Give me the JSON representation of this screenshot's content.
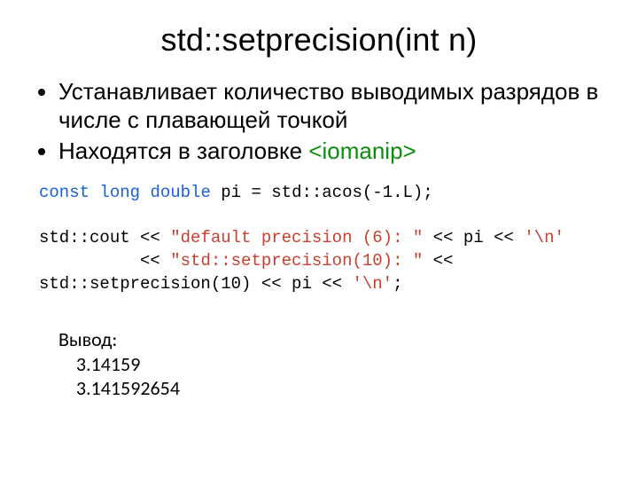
{
  "title": "std::setprecision(int n)",
  "bullets": [
    {
      "pre": "Устанавливает количество выводимых разрядов в числе с плавающей точкой",
      "header": ""
    },
    {
      "pre": "Находятся в заголовке ",
      "header": "<iomanip>"
    }
  ],
  "code": {
    "kw1": "const",
    "kw2": "long",
    "kw3": "double",
    "line1_rest": " pi = std::acos(-1.L);",
    "cout": "std::cout << ",
    "str1": "\"default precision (6): \"",
    "mid1": " << pi << ",
    "chr1": "'\\n'",
    "indent2": "          << ",
    "str2": "\"std::setprecision(10): \"",
    "mid2": " << ",
    "line3": "std::setprecision(10) << pi << ",
    "chr2": "'\\n'",
    "semi": ";"
  },
  "output": {
    "label": "Вывод:",
    "v1": "3.14159",
    "v2": "3.141592654"
  },
  "chart_data": {
    "type": "table",
    "title": "setprecision example output",
    "rows": [
      {
        "precision": 6,
        "value": "3.14159"
      },
      {
        "precision": 10,
        "value": "3.141592654"
      }
    ]
  }
}
